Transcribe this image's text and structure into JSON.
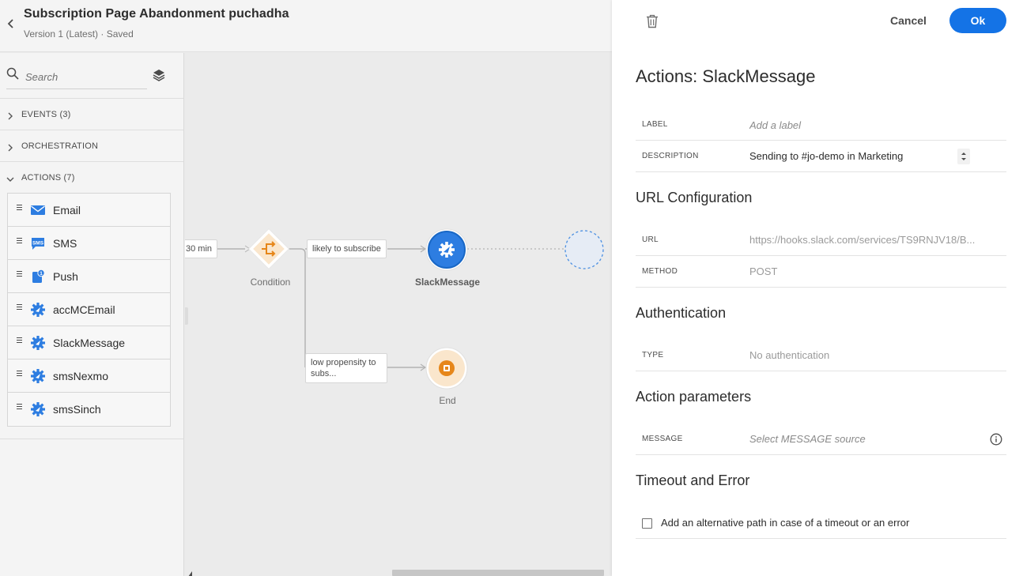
{
  "header": {
    "title": "Subscription Page Abandonment puchadha",
    "version": "Version 1 (Latest) · Saved"
  },
  "palette": {
    "search_placeholder": "Search",
    "sections": {
      "events": "EVENTS (3)",
      "orchestration": "ORCHESTRATION",
      "actions": "ACTIONS (7)"
    },
    "actions": [
      {
        "label": "Email",
        "icon": "email-icon"
      },
      {
        "label": "SMS",
        "icon": "sms-icon"
      },
      {
        "label": "Push",
        "icon": "push-icon"
      },
      {
        "label": "accMCEmail",
        "icon": "custom-action-icon"
      },
      {
        "label": "SlackMessage",
        "icon": "custom-action-icon"
      },
      {
        "label": "smsNexmo",
        "icon": "custom-action-icon"
      },
      {
        "label": "smsSinch",
        "icon": "custom-action-icon"
      }
    ],
    "sms_badge_text": "SMS",
    "push_badge_text": "1"
  },
  "canvas": {
    "wait_label": "30 min",
    "condition_label": "Condition",
    "path_likely": "likely to subscribe",
    "path_low": "low propensity to subs...",
    "slack_label": "SlackMessage",
    "end_label": "End"
  },
  "panel": {
    "cancel": "Cancel",
    "ok": "Ok",
    "title": "Actions: SlackMessage",
    "label_key": "LABEL",
    "label_placeholder": "Add a label",
    "description_key": "DESCRIPTION",
    "description_value": "Sending to #jo-demo in Marketing",
    "url_config_title": "URL Configuration",
    "url_key": "URL",
    "url_value": "https://hooks.slack.com/services/TS9RNJV18/B...",
    "method_key": "METHOD",
    "method_value": "POST",
    "auth_title": "Authentication",
    "type_key": "TYPE",
    "type_value": "No authentication",
    "params_title": "Action parameters",
    "message_key": "MESSAGE",
    "message_placeholder": "Select MESSAGE source",
    "timeout_title": "Timeout and Error",
    "timeout_checkbox_label": "Add an alternative path in case of a timeout or an error"
  },
  "colors": {
    "accent": "#1473e6",
    "condition": "#e68619",
    "end": "#e68619",
    "action_icon": "#2d7de1"
  }
}
